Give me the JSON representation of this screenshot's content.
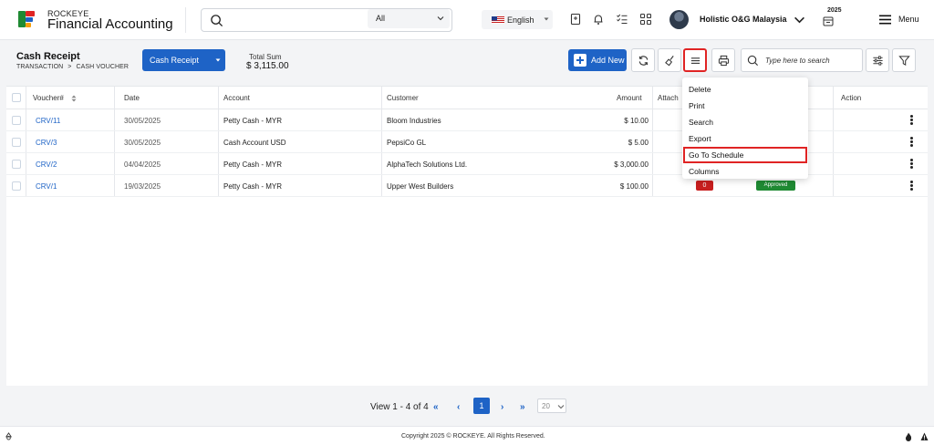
{
  "header": {
    "brand_top": "ROCKEYE",
    "brand_main": "Financial Accounting",
    "search_scope": "All",
    "language": "English",
    "company": "Holistic O&G Malaysia",
    "year": "2025",
    "menu_label": "Menu"
  },
  "page": {
    "title": "Cash Receipt",
    "breadcrumb": [
      "TRANSACTION",
      ">",
      "CASH VOUCHER"
    ],
    "type_button": "Cash Receipt",
    "total_label": "Total Sum",
    "total_value": "$ 3,115.00"
  },
  "toolbar": {
    "add_label": "Add New",
    "search_placeholder": "Type here to search"
  },
  "table": {
    "columns": {
      "voucher": "Voucher#",
      "date": "Date",
      "account": "Account",
      "customer": "Customer",
      "amount": "Amount",
      "attach": "Attach",
      "action": "Action"
    },
    "rows": [
      {
        "voucher": "CRV/11",
        "date": "30/05/2025",
        "account": "Petty Cash - MYR",
        "customer": "Bloom Industries",
        "amount": "$ 10.00"
      },
      {
        "voucher": "CRV/3",
        "date": "30/05/2025",
        "account": "Cash Account USD",
        "customer": "PepsiCo GL",
        "amount": "$ 5.00"
      },
      {
        "voucher": "CRV/2",
        "date": "04/04/2025",
        "account": "Petty Cash - MYR",
        "customer": "AlphaTech Solutions Ltd.",
        "amount": "$ 3,000.00"
      },
      {
        "voucher": "CRV/1",
        "date": "19/03/2025",
        "account": "Petty Cash - MYR",
        "customer": "Upper West Builders",
        "amount": "$ 100.00",
        "attach_count": "0",
        "status": "Approved"
      }
    ]
  },
  "dropdown": {
    "items": [
      "Delete",
      "Print",
      "Search",
      "Export",
      "Go To Schedule",
      "Columns"
    ],
    "highlighted": "Go To Schedule"
  },
  "pagination": {
    "view_text": "View 1 - 4 of 4",
    "current": "1",
    "page_size": "20"
  },
  "footer": {
    "copyright": "Copyright 2025 © ROCKEYE. All Rights Reserved."
  },
  "colors": {
    "primary": "#1e63c6",
    "highlight": "#e02424",
    "approved": "#1f8a33",
    "danger": "#c81e1e"
  }
}
